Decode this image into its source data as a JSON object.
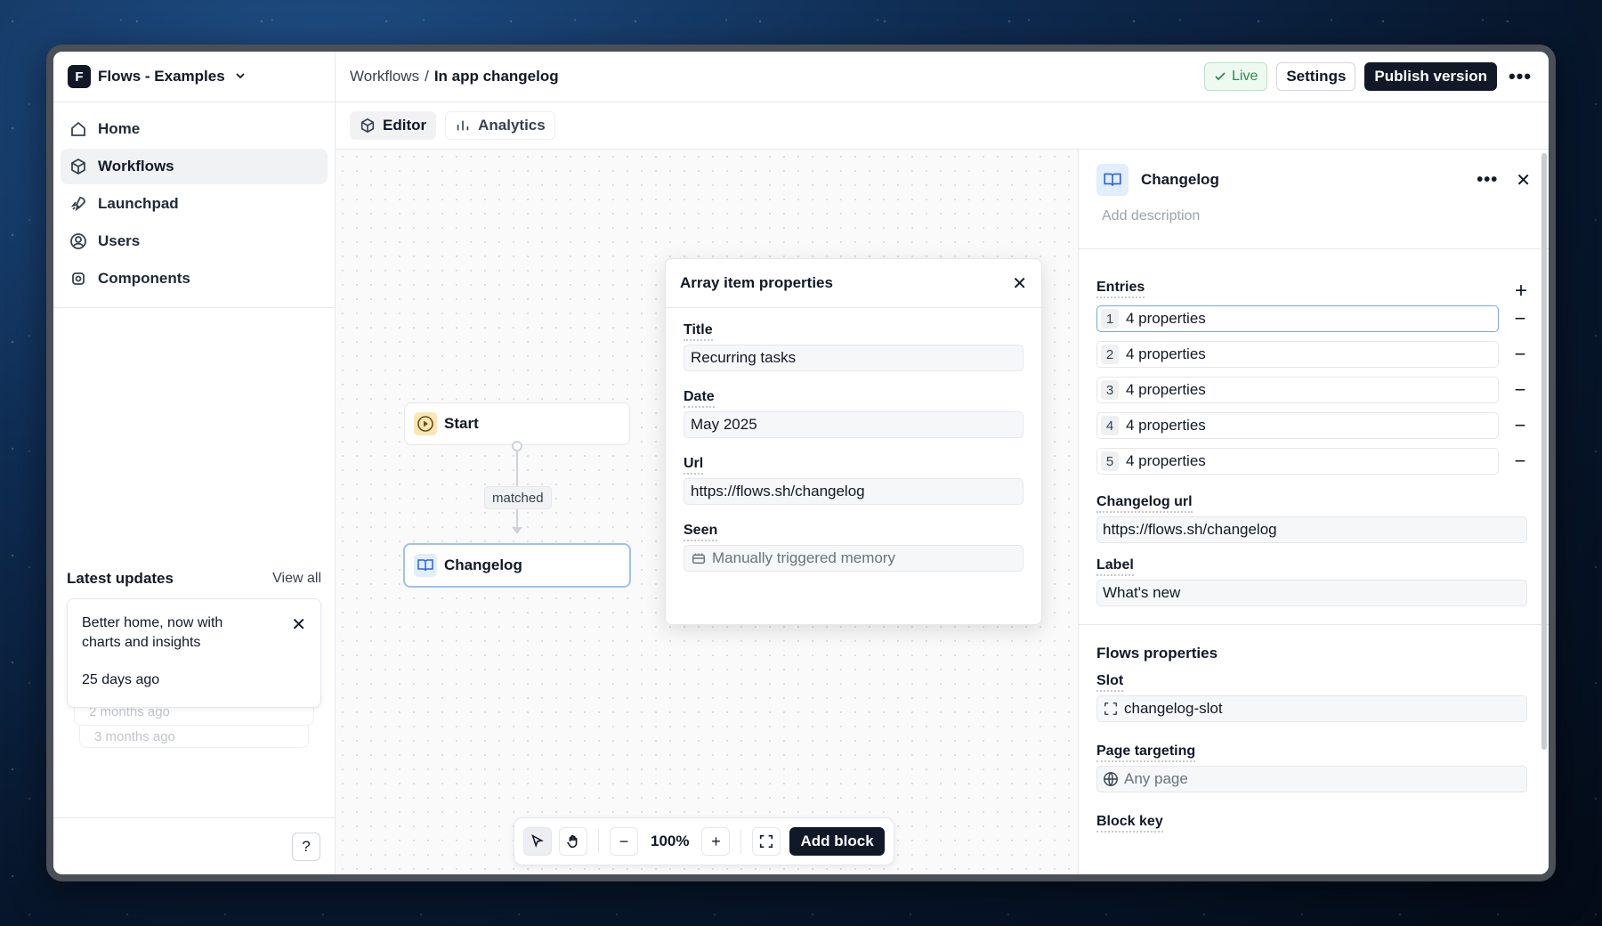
{
  "org": {
    "badge": "F",
    "name": "Flows - Examples"
  },
  "nav": [
    {
      "label": "Home"
    },
    {
      "label": "Workflows"
    },
    {
      "label": "Launchpad"
    },
    {
      "label": "Users"
    },
    {
      "label": "Components"
    }
  ],
  "updates": {
    "title": "Latest updates",
    "view_all": "View all",
    "card": {
      "text": "Better home, now with charts and insights",
      "time": "25 days ago"
    },
    "stack": [
      "2 months ago",
      "3 months ago"
    ]
  },
  "help": "?",
  "breadcrumb": {
    "parent": "Workflows",
    "sep": "/",
    "current": "In app changelog"
  },
  "topbar": {
    "live": "Live",
    "settings": "Settings",
    "publish": "Publish version",
    "more": "•••"
  },
  "tabs": [
    {
      "label": "Editor"
    },
    {
      "label": "Analytics"
    }
  ],
  "canvas": {
    "start_node": "Start",
    "edge_label": "matched",
    "changelog_node": "Changelog"
  },
  "toolbar": {
    "zoom": "100%",
    "add_block": "Add block",
    "minus": "−",
    "plus": "+"
  },
  "popover": {
    "title": "Array item properties",
    "fields": [
      {
        "label": "Title",
        "value": "Recurring tasks"
      },
      {
        "label": "Date",
        "value": "May 2025"
      },
      {
        "label": "Url",
        "value": "https://flows.sh/changelog"
      },
      {
        "label": "Seen",
        "value": "Manually triggered memory"
      }
    ]
  },
  "panel": {
    "title": "Changelog",
    "description_placeholder": "Add description",
    "entries_label": "Entries",
    "entries": [
      {
        "index": "1",
        "text": "4 properties"
      },
      {
        "index": "2",
        "text": "4 properties"
      },
      {
        "index": "3",
        "text": "4 properties"
      },
      {
        "index": "4",
        "text": "4 properties"
      },
      {
        "index": "5",
        "text": "4 properties"
      }
    ],
    "changelog_url_label": "Changelog url",
    "changelog_url": "https://flows.sh/changelog",
    "label_label": "Label",
    "label_value": "What's new",
    "flows_properties": "Flows properties",
    "slot_label": "Slot",
    "slot_value": "changelog-slot",
    "page_targeting_label": "Page targeting",
    "page_targeting_value": "Any page",
    "block_key_label": "Block key"
  },
  "colors": {
    "accent": "#111827",
    "live": "#2f8a4a",
    "selection": "#6ea8f0"
  }
}
